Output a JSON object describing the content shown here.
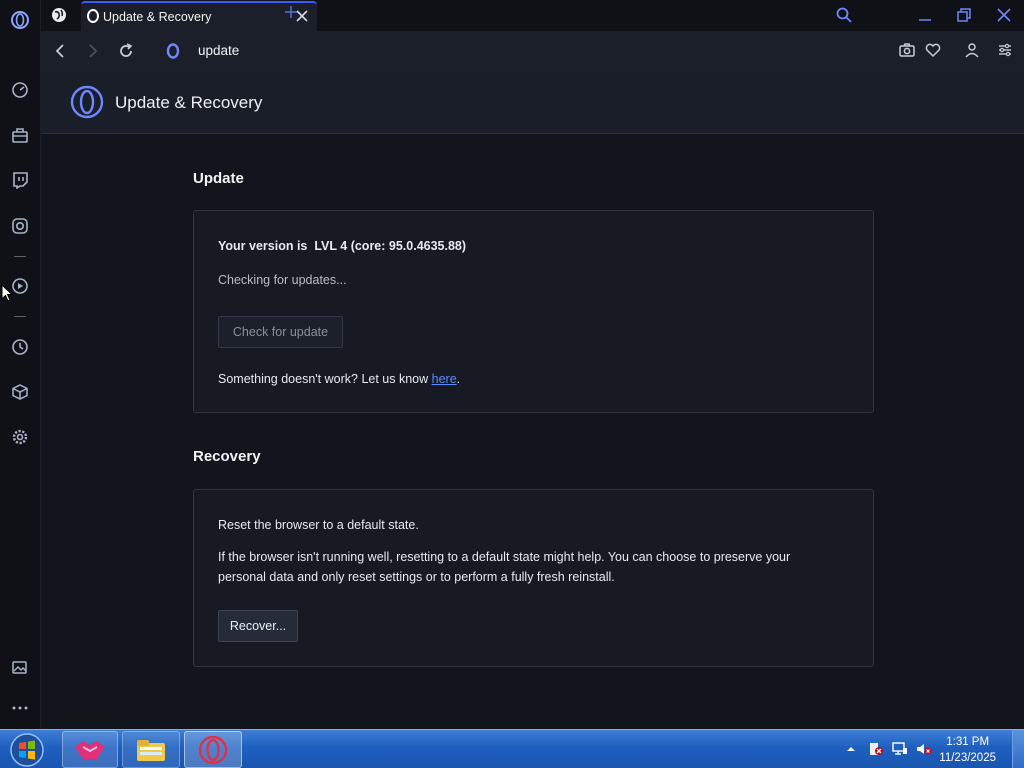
{
  "tab": {
    "title": "Update & Recovery"
  },
  "address": {
    "url": "update"
  },
  "page": {
    "header_title": "Update & Recovery"
  },
  "update": {
    "section_title": "Update",
    "version_prefix": "Your version is",
    "version_value": "LVL 4 (core: 95.0.4635.88)",
    "status": "Checking for updates...",
    "check_button": "Check for update",
    "feedback_text": "Something doesn't work? Let us know",
    "feedback_link": "here",
    "feedback_suffix": "."
  },
  "recovery": {
    "section_title": "Recovery",
    "line1": "Reset the browser to a default state.",
    "line2": "If the browser isn't running well, resetting to a default state might help. You can choose to preserve your",
    "line3": "personal data and only reset settings or to perform a fully fresh reinstall.",
    "recover_button": "Recover..."
  },
  "taskbar": {
    "time": "1:31 PM",
    "date": "11/23/2025"
  },
  "colors": {
    "accent": "#3a5cff",
    "opera_red": "#e0304a",
    "link": "#5b8cff",
    "taskbar": "#1f5fbf"
  },
  "icons": {
    "sidebar": [
      "opera-logo-icon",
      "speed-dial-icon",
      "gx-corner-icon",
      "twitch-icon",
      "instagram-icon",
      "player-icon",
      "history-icon",
      "extensions-icon",
      "settings-icon",
      "gallery-icon",
      "more-icon"
    ],
    "toolbar": [
      "snapshot-icon",
      "heart-icon",
      "account-icon",
      "easy-setup-icon"
    ]
  }
}
